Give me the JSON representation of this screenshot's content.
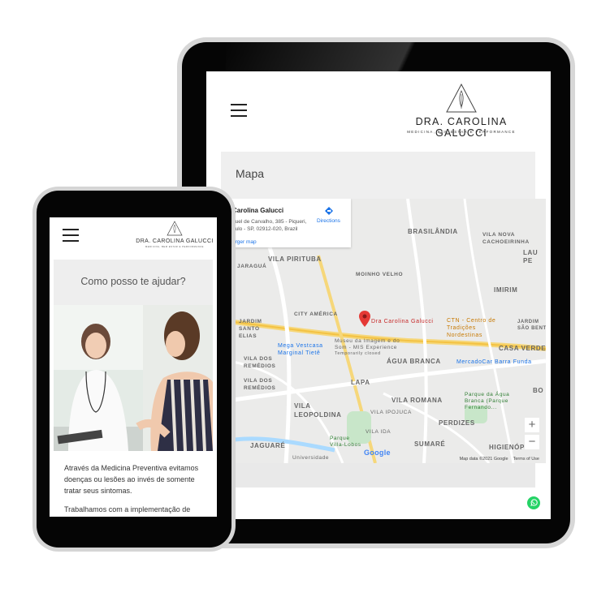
{
  "tablet": {
    "logo": {
      "brand": "DRA. CAROLINA GALUCCI",
      "tagline": "MEDICINA, BEM ESTAR E PERFORMANCE"
    },
    "map_section_title": "Mapa",
    "map_card": {
      "name": "Carolina Galucci",
      "address": "nuel de Carvalho, 385 - Piqueri, aulo - SP, 02912-020, Brazil",
      "larger_map": "arger map",
      "directions": "Directions"
    },
    "map_labels": {
      "brasilandia": "BRASILÂNDIA",
      "vila_pirituba": "VILA PIRITUBA",
      "jaragua": "JARAGUÁ",
      "vila_nova_cachoeirinha": "VILA NOVA CACHOEIRINHA",
      "lau": "LAU PE",
      "moinho_velho": "MOINHO VELHO",
      "imirim": "IMIRIM",
      "city_america": "CITY AMÉRICA",
      "jardim_santo_elias": "JARDIM SANTO ELIAS",
      "pin_label": "Dra Carolina Galucci",
      "ctn": "CTN - Centro de Tradições Nordestinas",
      "jardim_sao_bento": "JARDIM SÃO BENT",
      "museu": "Museu da Imagem e do Som - MIS Experience",
      "temporarily_closed": "Temporarily closed",
      "mega": "Mega Vestcasa Marginal Tietê",
      "vila_dos_remedios_1": "VILA DOS REMÉDIOS",
      "agua_branca": "ÁGUA BRANCA",
      "mercadocar": "MercadoCar Barra Funda",
      "casa_verde": "CASA VERDE",
      "vila_dos_remedios_2": "VILA DOS REMÉDIOS",
      "lapa": "LAPA",
      "bo": "BO",
      "vila_leopoldina": "VILA LEOPOLDINA",
      "vila_romana": "VILA ROMANA",
      "parque_agua_branca": "Parque da Água Branca (Parque Fernando...",
      "vila_ipojuca": "VILA IPOJUCA",
      "perdizes": "PERDIZES",
      "vila_ida": "VILA IDA",
      "jaguare": "JAGUARÉ",
      "parque_villa_lobos": "Parque Villa-Lobos",
      "sumare": "SUMARÉ",
      "higienopolis": "HIGIENÓPO",
      "universidade": "Universidade"
    },
    "map_attribution": {
      "data": "Map data ©2021 Google",
      "terms": "Terms of Use"
    },
    "zoom": {
      "plus": "+",
      "minus": "−"
    },
    "google_logo": "Google",
    "icons": {
      "menu": "hamburger-icon",
      "whatsapp": "whatsapp-icon",
      "pin": "map-pin-icon"
    }
  },
  "phone": {
    "logo": {
      "brand": "DRA. CAROLINA GALUCCI",
      "tagline": "MEDICINA, BEM ESTAR E PERFORMANCE"
    },
    "help_title": "Como posso te ajudar?",
    "paragraphs": [
      "Através da Medicina Preventiva evitamos doenças ou lesões ao invés de somente tratar seus sintomas.",
      "Trabalhamos com a implementação de"
    ]
  },
  "colors": {
    "device_frame": "#050505",
    "map_bg": "#ebebea",
    "pin": "#e53935",
    "whatsapp": "#25d366",
    "link": "#1a73e8"
  }
}
